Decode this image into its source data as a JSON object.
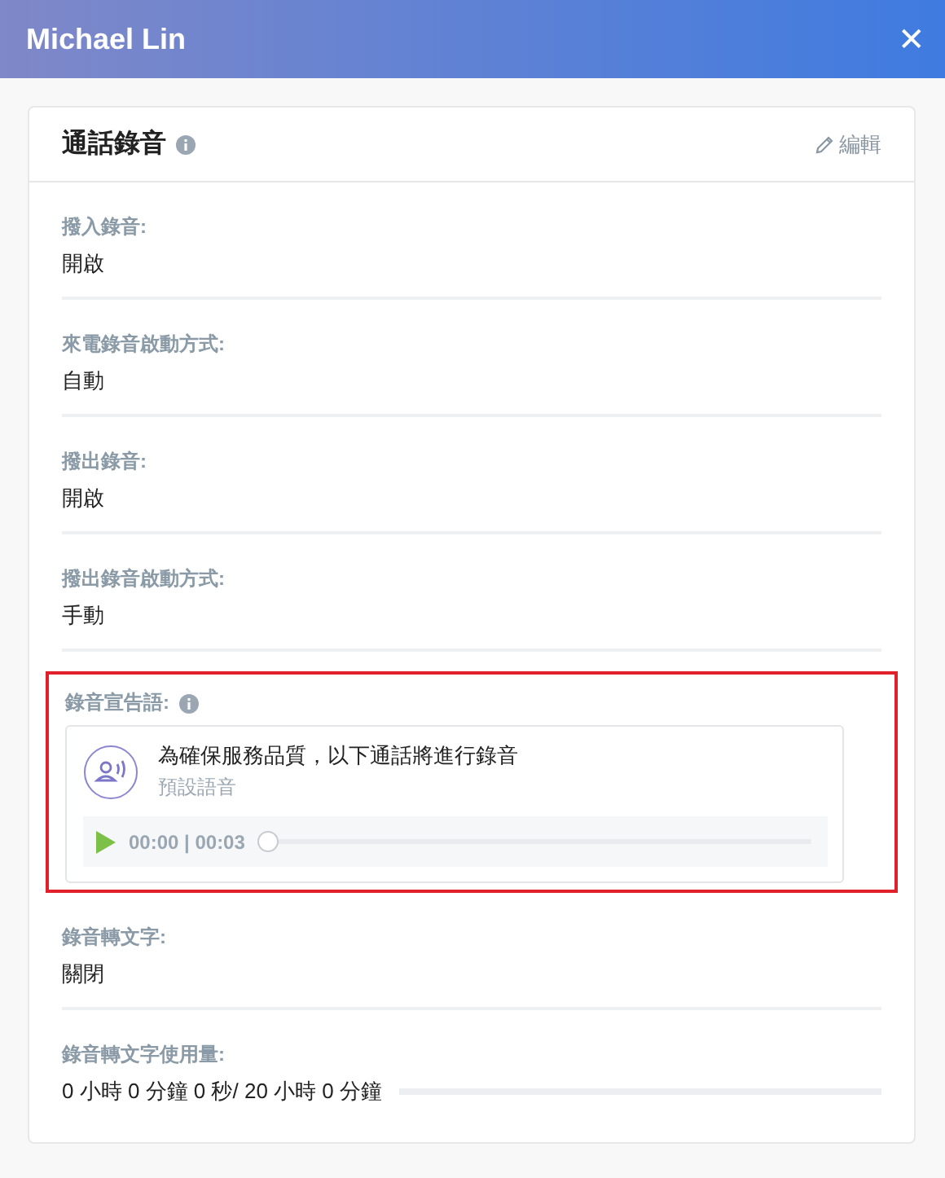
{
  "header": {
    "title": "Michael Lin",
    "close": "✕"
  },
  "card": {
    "title": "通話錄音",
    "edit": "編輯"
  },
  "fields": [
    {
      "kind": "text",
      "label": "撥入錄音:",
      "value": "開啟"
    },
    {
      "kind": "text",
      "label": "來電錄音啟動方式:",
      "value": "自動"
    },
    {
      "kind": "text",
      "label": "撥出錄音:",
      "value": "開啟"
    },
    {
      "kind": "text",
      "label": "撥出錄音啟動方式:",
      "value": "手動"
    },
    {
      "kind": "announcement",
      "label": "錄音宣告語:",
      "info": true,
      "highlighted": true,
      "message": "為確保服務品質，以下通話將進行錄音",
      "source": "預設語音",
      "time": "00:00 | 00:03",
      "level": 0
    },
    {
      "kind": "text",
      "label": "錄音轉文字:",
      "value": "關閉"
    },
    {
      "kind": "usage",
      "label": "錄音轉文字使用量:",
      "value": "0 小時 0 分鐘 0 秒/ 20 小時 0 分鐘",
      "level": 0
    }
  ]
}
